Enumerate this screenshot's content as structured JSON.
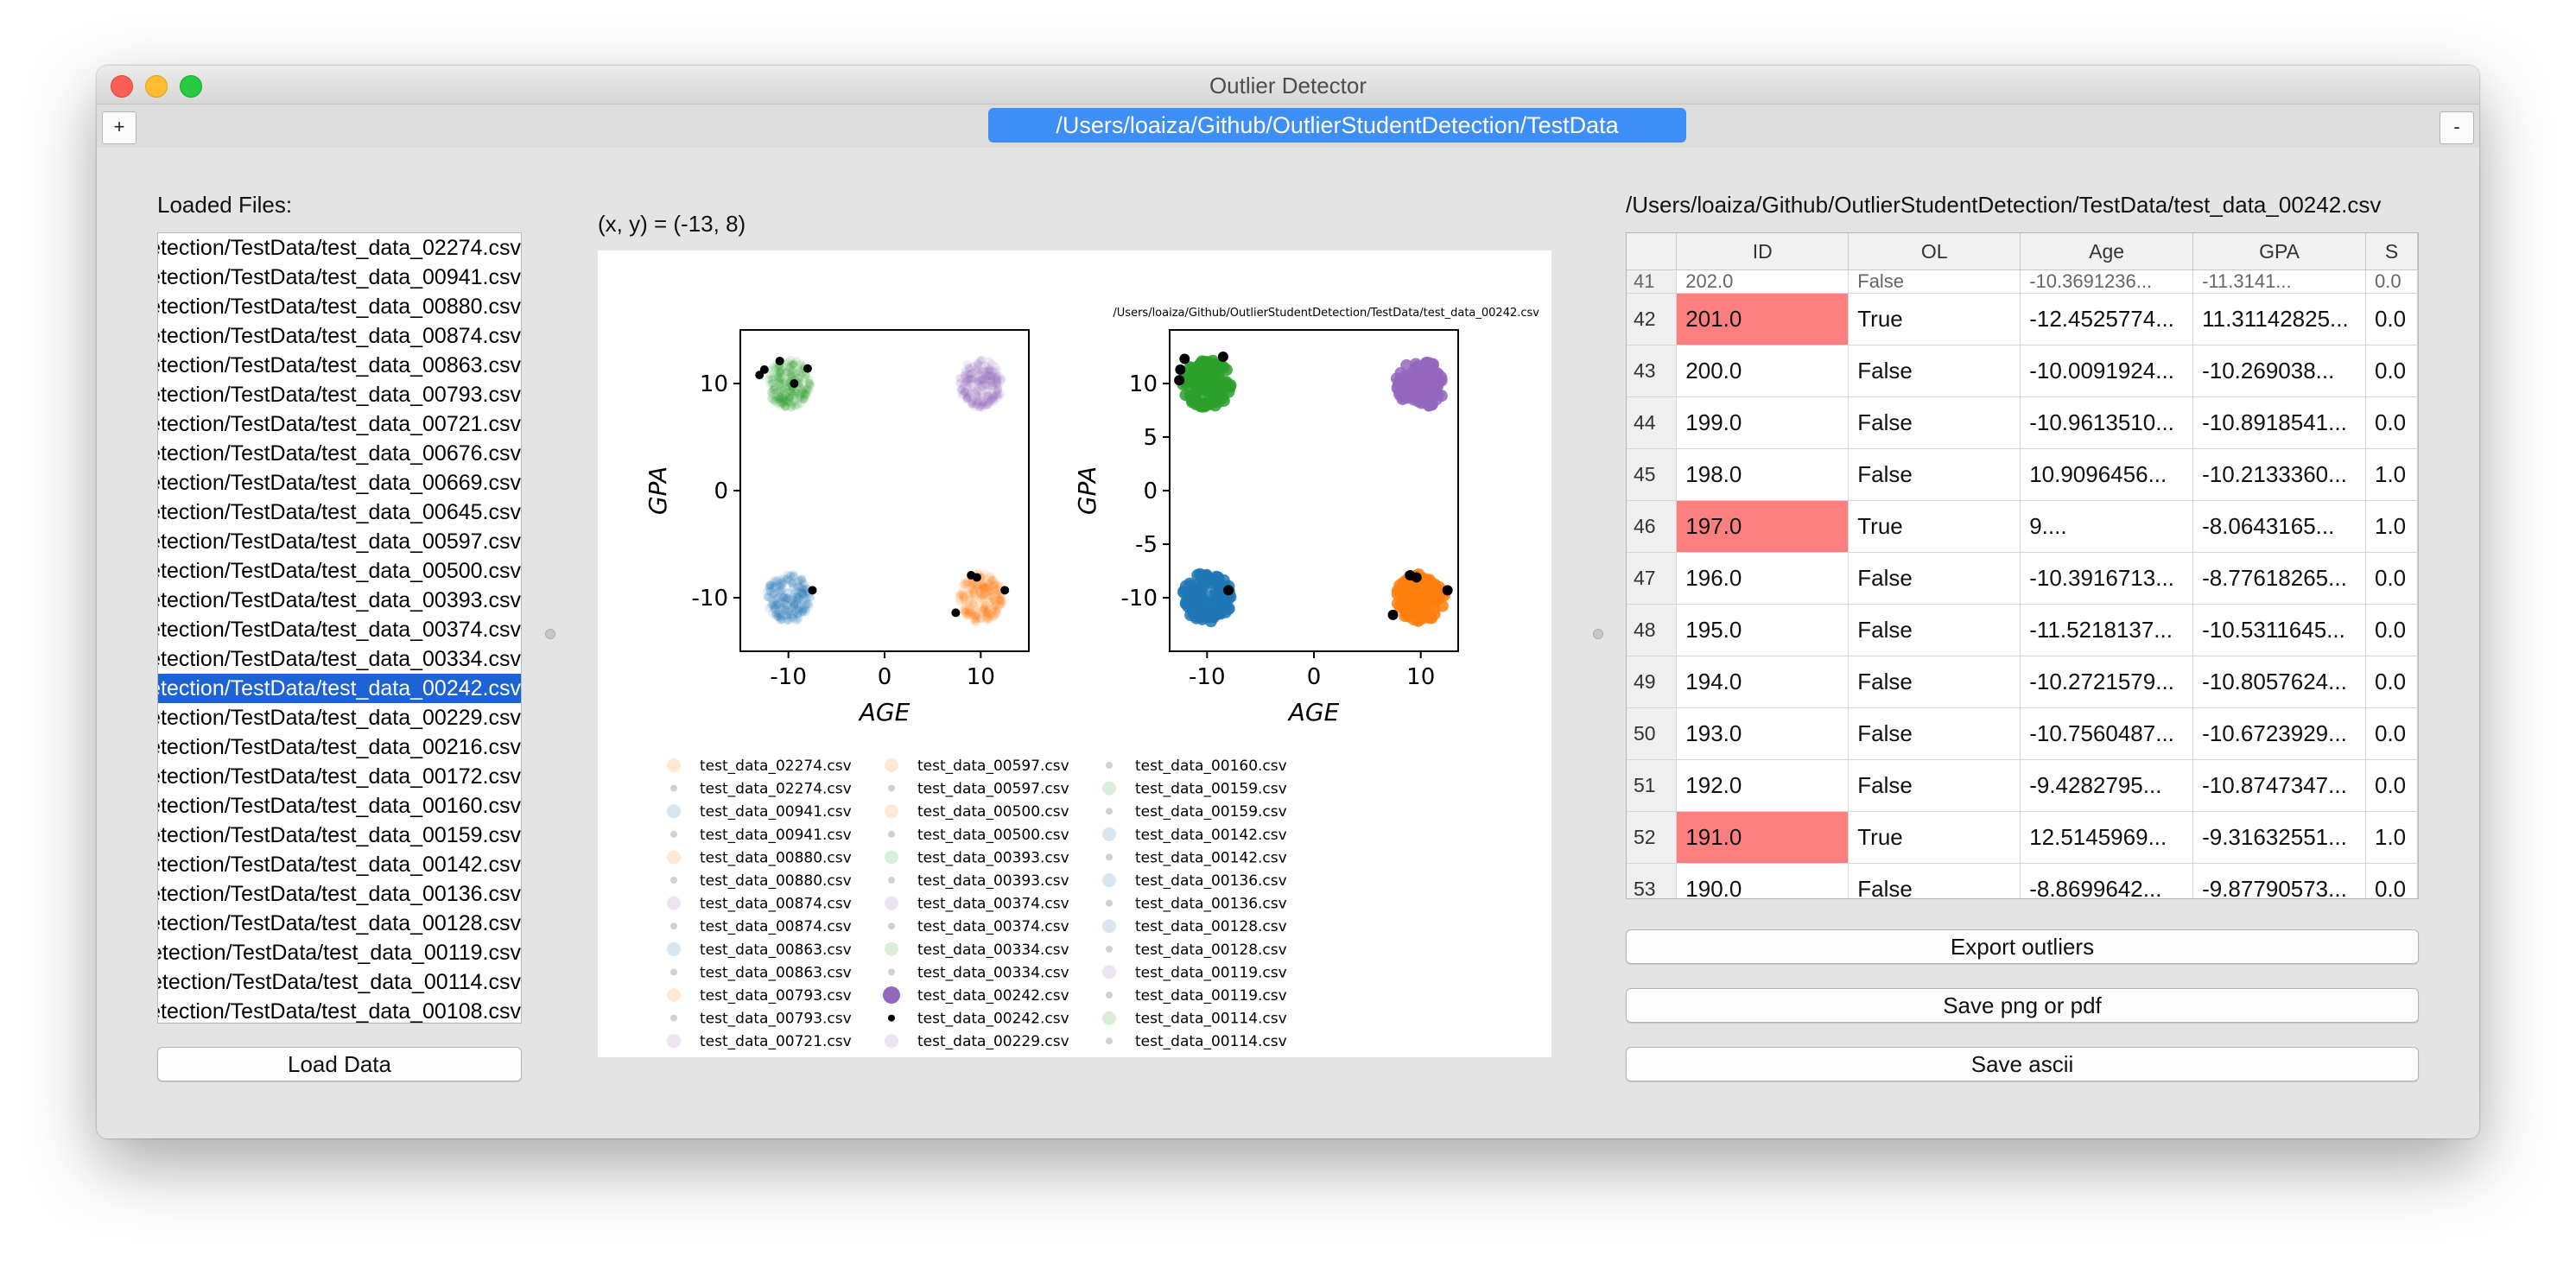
{
  "window": {
    "title": "Outlier Detector"
  },
  "tabbar": {
    "add_label": "+",
    "remove_label": "-",
    "path_tab": "/Users/loaiza/Github/OutlierStudentDetection/TestData"
  },
  "left": {
    "heading": "Loaded Files:",
    "files": [
      "etection/TestData/test_data_02274.csv",
      "etection/TestData/test_data_00941.csv",
      "etection/TestData/test_data_00880.csv",
      "etection/TestData/test_data_00874.csv",
      "etection/TestData/test_data_00863.csv",
      "etection/TestData/test_data_00793.csv",
      "etection/TestData/test_data_00721.csv",
      "etection/TestData/test_data_00676.csv",
      "etection/TestData/test_data_00669.csv",
      "etection/TestData/test_data_00645.csv",
      "etection/TestData/test_data_00597.csv",
      "etection/TestData/test_data_00500.csv",
      "etection/TestData/test_data_00393.csv",
      "etection/TestData/test_data_00374.csv",
      "etection/TestData/test_data_00334.csv",
      "etection/TestData/test_data_00242.csv",
      "etection/TestData/test_data_00229.csv",
      "etection/TestData/test_data_00216.csv",
      "etection/TestData/test_data_00172.csv",
      "etection/TestData/test_data_00160.csv",
      "etection/TestData/test_data_00159.csv",
      "etection/TestData/test_data_00142.csv",
      "etection/TestData/test_data_00136.csv",
      "etection/TestData/test_data_00128.csv",
      "etection/TestData/test_data_00119.csv",
      "etection/TestData/test_data_00114.csv",
      "etection/TestData/test_data_00108.csv"
    ],
    "selected_index": 15,
    "load_button": "Load Data"
  },
  "center": {
    "coord_readout": "(x, y) = (-13,   8)",
    "figure_path": "/Users/loaiza/Github/OutlierStudentDetection/TestData/test_data_00242.csv",
    "legend_columns": [
      [
        "test_data_02274.csv",
        "test_data_02274.csv",
        "test_data_00941.csv",
        "test_data_00941.csv",
        "test_data_00880.csv",
        "test_data_00880.csv",
        "test_data_00874.csv",
        "test_data_00874.csv",
        "test_data_00863.csv",
        "test_data_00863.csv",
        "test_data_00793.csv",
        "test_data_00793.csv",
        "test_data_00721.csv"
      ],
      [
        "test_data_00597.csv",
        "test_data_00597.csv",
        "test_data_00500.csv",
        "test_data_00500.csv",
        "test_data_00393.csv",
        "test_data_00393.csv",
        "test_data_00374.csv",
        "test_data_00374.csv",
        "test_data_00334.csv",
        "test_data_00334.csv",
        "test_data_00242.csv",
        "test_data_00242.csv",
        "test_data_00229.csv"
      ],
      [
        "test_data_00160.csv",
        "test_data_00159.csv",
        "test_data_00159.csv",
        "test_data_00142.csv",
        "test_data_00142.csv",
        "test_data_00136.csv",
        "test_data_00136.csv",
        "test_data_00128.csv",
        "test_data_00128.csv",
        "test_data_00119.csv",
        "test_data_00119.csv",
        "test_data_00114.csv",
        "test_data_00114.csv"
      ]
    ],
    "legend_colors": [
      "#ff7f0e",
      "#999999",
      "#1f77b4",
      "#999999",
      "#ff7f0e",
      "#999999",
      "#9467bd",
      "#999999",
      "#1f77b4",
      "#999999",
      "#ff7f0e",
      "#999999",
      "#9467bd"
    ],
    "legend_colors_col2": [
      "#ff7f0e",
      "#999999",
      "#ff7f0e",
      "#999999",
      "#2ca02c",
      "#999999",
      "#9467bd",
      "#999999",
      "#2ca02c",
      "#999999",
      "#9467bd",
      "#000000",
      "#9467bd"
    ],
    "legend_colors_col3": [
      "#999999",
      "#2ca02c",
      "#999999",
      "#1f77b4",
      "#999999",
      "#1f77b4",
      "#999999",
      "#1f77b4",
      "#999999",
      "#9467bd",
      "#999999",
      "#2ca02c",
      "#999999"
    ]
  },
  "chart_data": [
    {
      "type": "scatter",
      "title": "",
      "xlabel": "AGE",
      "ylabel": "GPA",
      "xlim": [
        -15,
        15
      ],
      "ylim": [
        -15,
        15
      ],
      "xticks": [
        -10,
        0,
        10
      ],
      "yticks": [
        -10,
        0,
        10
      ],
      "clusters": [
        {
          "color": "#2ca02c",
          "center": [
            -10,
            10
          ]
        },
        {
          "color": "#9467bd",
          "center": [
            10,
            10
          ]
        },
        {
          "color": "#1f77b4",
          "center": [
            -10,
            -10
          ]
        },
        {
          "color": "#ff7f0e",
          "center": [
            10,
            -10
          ]
        }
      ],
      "outliers": [
        [
          -12.5,
          11.3
        ],
        [
          -10.9,
          12.1
        ],
        [
          -13.0,
          10.8
        ],
        [
          -8.0,
          11.4
        ],
        [
          -9.4,
          10.0
        ],
        [
          -7.5,
          -9.3
        ],
        [
          9.6,
          -8.1
        ],
        [
          12.5,
          -9.3
        ],
        [
          7.4,
          -11.4
        ],
        [
          9.0,
          -7.9
        ]
      ]
    },
    {
      "type": "scatter",
      "title": "/Users/loaiza/Github/OutlierStudentDetection/TestData/test_data_00242.csv",
      "xlabel": "AGE",
      "ylabel": "GPA",
      "xlim": [
        -13.5,
        13.5
      ],
      "ylim": [
        -15,
        15
      ],
      "xticks": [
        -10,
        0,
        10
      ],
      "yticks": [
        -10,
        -5,
        0,
        5,
        10
      ],
      "clusters": [
        {
          "color": "#2ca02c",
          "center": [
            -10,
            10
          ]
        },
        {
          "color": "#9467bd",
          "center": [
            10,
            10
          ]
        },
        {
          "color": "#1f77b4",
          "center": [
            -10,
            -10
          ]
        },
        {
          "color": "#ff7f0e",
          "center": [
            10,
            -10
          ]
        }
      ],
      "outliers": [
        [
          -12.5,
          11.3
        ],
        [
          -12.1,
          12.3
        ],
        [
          -8.5,
          12.5
        ],
        [
          -12.6,
          10.3
        ],
        [
          -8.0,
          -9.3
        ],
        [
          9.6,
          -8.1
        ],
        [
          12.5,
          -9.3
        ],
        [
          7.4,
          -11.6
        ],
        [
          9.0,
          -7.9
        ]
      ]
    }
  ],
  "right": {
    "path": "/Users/loaiza/Github/OutlierStudentDetection/TestData/test_data_00242.csv",
    "columns": [
      "ID",
      "OL",
      "Age",
      "GPA",
      "S"
    ],
    "partial_row": [
      "41",
      "202.0",
      "False",
      "-10.3691236...",
      "-11.3141...",
      "0.0"
    ],
    "rows": [
      {
        "n": "42",
        "id": "201.0",
        "ol": "True",
        "age": "-12.4525774...",
        "gpa": "11.31142825...",
        "s": "0.0",
        "hl": true
      },
      {
        "n": "43",
        "id": "200.0",
        "ol": "False",
        "age": "-10.0091924...",
        "gpa": "-10.269038...",
        "s": "0.0",
        "hl": false
      },
      {
        "n": "44",
        "id": "199.0",
        "ol": "False",
        "age": "-10.9613510...",
        "gpa": "-10.8918541...",
        "s": "0.0",
        "hl": false
      },
      {
        "n": "45",
        "id": "198.0",
        "ol": "False",
        "age": "10.9096456...",
        "gpa": "-10.2133360...",
        "s": "1.0",
        "hl": false
      },
      {
        "n": "46",
        "id": "197.0",
        "ol": "True",
        "age": "9....",
        "gpa": "-8.0643165...",
        "s": "1.0",
        "hl": true
      },
      {
        "n": "47",
        "id": "196.0",
        "ol": "False",
        "age": "-10.3916713...",
        "gpa": "-8.77618265...",
        "s": "0.0",
        "hl": false
      },
      {
        "n": "48",
        "id": "195.0",
        "ol": "False",
        "age": "-11.5218137...",
        "gpa": "-10.5311645...",
        "s": "0.0",
        "hl": false
      },
      {
        "n": "49",
        "id": "194.0",
        "ol": "False",
        "age": "-10.2721579...",
        "gpa": "-10.8057624...",
        "s": "0.0",
        "hl": false
      },
      {
        "n": "50",
        "id": "193.0",
        "ol": "False",
        "age": "-10.7560487...",
        "gpa": "-10.6723929...",
        "s": "0.0",
        "hl": false
      },
      {
        "n": "51",
        "id": "192.0",
        "ol": "False",
        "age": "-9.4282795...",
        "gpa": "-10.8747347...",
        "s": "0.0",
        "hl": false
      },
      {
        "n": "52",
        "id": "191.0",
        "ol": "True",
        "age": "12.5145969...",
        "gpa": "-9.31632551...",
        "s": "1.0",
        "hl": true
      },
      {
        "n": "53",
        "id": "190.0",
        "ol": "False",
        "age": "-8.8699642...",
        "gpa": "-9.87790573...",
        "s": "0.0",
        "hl": false
      }
    ],
    "buttons": {
      "export": "Export outliers",
      "save_png": "Save png or pdf",
      "save_ascii": "Save ascii"
    }
  }
}
